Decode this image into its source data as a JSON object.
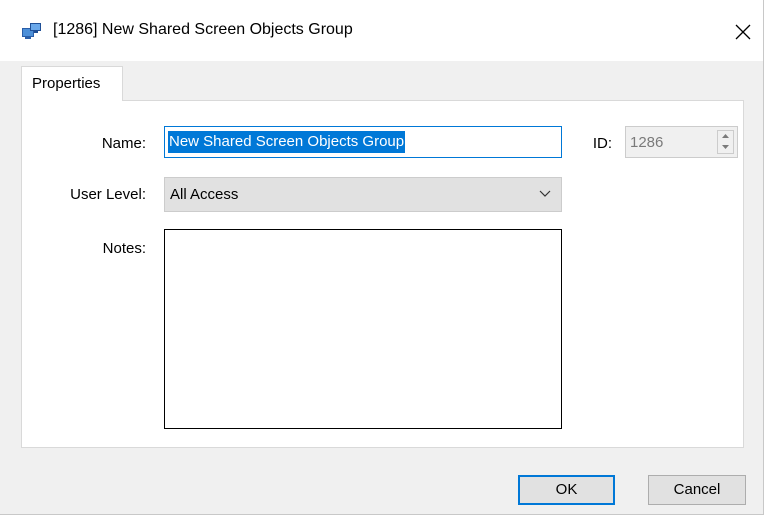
{
  "window": {
    "title": "[1286] New Shared Screen Objects Group",
    "icon": "shared-objects-icon",
    "close_icon": "close-icon"
  },
  "tabs": [
    {
      "label": "Properties",
      "selected": true
    }
  ],
  "form": {
    "name_label": "Name:",
    "name_value": "New Shared Screen Objects Group",
    "id_label": "ID:",
    "id_value": "1286",
    "user_level_label": "User Level:",
    "user_level_value": "All Access",
    "notes_label": "Notes:",
    "notes_value": ""
  },
  "buttons": {
    "ok": "OK",
    "cancel": "Cancel"
  },
  "colors": {
    "accent": "#0078d7",
    "window_bg": "#f0f0f0",
    "panel_bg": "#ffffff",
    "button_bg": "#e1e1e1"
  }
}
